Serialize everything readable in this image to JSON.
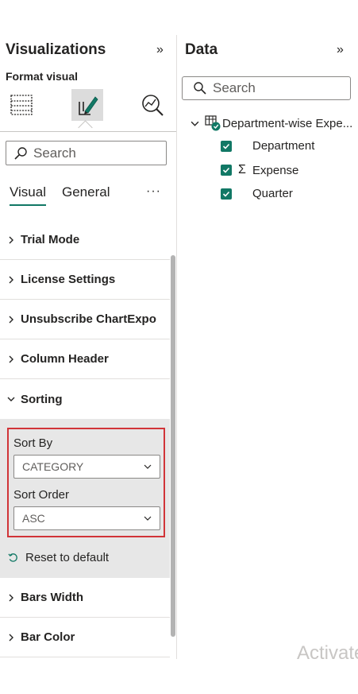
{
  "visualizations": {
    "title": "Visualizations",
    "expand_glyph": "»",
    "format_visual_label": "Format visual",
    "tools": [
      {
        "name": "build-visual-icon",
        "active": false
      },
      {
        "name": "format-visual-icon",
        "active": true
      },
      {
        "name": "analytics-icon",
        "active": false
      }
    ],
    "search": {
      "placeholder": "Search"
    },
    "tabs": [
      {
        "label": "Visual",
        "active": true
      },
      {
        "label": "General",
        "active": false
      }
    ],
    "more_glyph": "···",
    "sections": [
      {
        "label": "Trial Mode",
        "expanded": false
      },
      {
        "label": "License Settings",
        "expanded": false
      },
      {
        "label": "Unsubscribe ChartExpo",
        "expanded": false
      },
      {
        "label": "Column Header",
        "expanded": false
      },
      {
        "label": "Sorting",
        "expanded": true
      },
      {
        "label": "Bars Width",
        "expanded": false
      },
      {
        "label": "Bar Color",
        "expanded": false
      }
    ],
    "sorting": {
      "sort_by_label": "Sort By",
      "sort_by_value": "CATEGORY",
      "sort_order_label": "Sort Order",
      "sort_order_value": "ASC",
      "reset_label": "Reset to default"
    }
  },
  "data_pane": {
    "title": "Data",
    "expand_glyph": "»",
    "search": {
      "placeholder": "Search"
    },
    "table": {
      "name": "Department-wise Expe..."
    },
    "fields": [
      {
        "label": "Department",
        "checked": true,
        "sigma": false
      },
      {
        "label": "Expense",
        "checked": true,
        "sigma": true
      },
      {
        "label": "Quarter",
        "checked": true,
        "sigma": false
      }
    ]
  },
  "watermark": "Activate",
  "colors": {
    "accent": "#117865",
    "highlight_border": "#d13438",
    "expanded_bg": "#e7e7e7"
  }
}
